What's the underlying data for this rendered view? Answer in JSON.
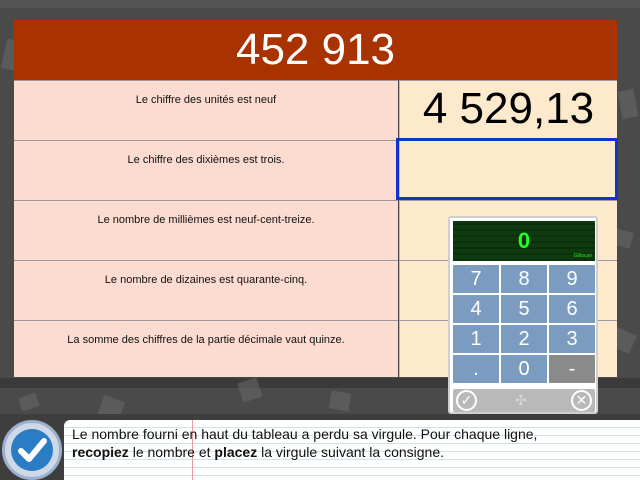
{
  "title_number": "452 913",
  "rows": [
    {
      "consigne": "Le chiffre des unités est neuf",
      "answer": "4 529,13"
    },
    {
      "consigne": "Le chiffre des dixièmes est trois.",
      "answer": ""
    },
    {
      "consigne": "Le nombre de millièmes est neuf-cent-treize.",
      "answer": ""
    },
    {
      "consigne": "Le nombre de dizaines est quarante-cinq.",
      "answer": ""
    },
    {
      "consigne": "La somme des chiffres de la partie décimale vaut quinze.",
      "answer": ""
    }
  ],
  "keypad": {
    "display": "0",
    "brand": "Gtitscan",
    "keys": [
      "7",
      "8",
      "9",
      "4",
      "5",
      "6",
      "1",
      "2",
      "3",
      ".",
      "0",
      "-"
    ],
    "ok_icon": "check-icon",
    "move_icon": "move-icon",
    "close_icon": "close-icon"
  },
  "instruction": {
    "part1": "Le nombre fourni en haut du tableau a perdu sa virgule. Pour chaque ligne,",
    "bold1": "recopiez",
    "part2": " le nombre et ",
    "bold2": "placez",
    "part3": " la virgule suivant la consigne."
  },
  "colors": {
    "title_bg": "#a83200",
    "consigne_bg": "#fcdcd0",
    "answer_bg": "#fdeacc",
    "active_border": "#1133cc",
    "key_bg": "#7b9cc0",
    "display_text": "#22ff22"
  }
}
